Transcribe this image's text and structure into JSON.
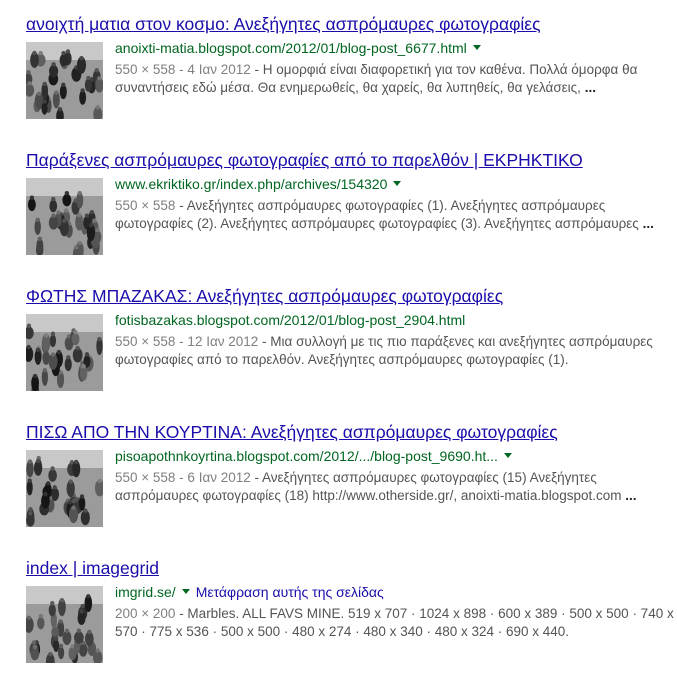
{
  "results": [
    {
      "title": "ανοιχτή ματια στον κοσμο: Ανεξήγητες ασπρόμαυρες φωτογραφίες",
      "url": "anoixti-matia.blogspot.com/2012/01/blog-post_6677.html",
      "meta": "550 × 558 - 4 Ιαν 2012",
      "snippet": " - Η ομορφιά είναι διαφορετική για τον καθένα. Πολλά όμορφα θα συναντήσεις εδώ μέσα. Θα ενημερωθείς, θα χαρείς, θα λυπηθείς, θα γελάσεις, ",
      "ellipsis": "..."
    },
    {
      "title": "Παράξενες ασπρόμαυρες φωτογραφίες από το παρελθόν | ΕΚΡΗΚΤΙΚΟ",
      "url": "www.ekriktiko.gr/index.php/archives/154320",
      "meta": "550 × 558",
      "snippet": " - Ανεξήγητες ασπρόμαυρες φωτογραφίες (1). Ανεξήγητες ασπρόμαυρες φωτογραφίες (2). Ανεξήγητες ασπρόμαυρες φωτογραφίες (3). Ανεξήγητες ασπρόμαυρες ",
      "ellipsis": "..."
    },
    {
      "title": "ΦΩΤΗΣ ΜΠΑΖΑΚΑΣ: Ανεξήγητες ασπρόμαυρες φωτογραφίες",
      "url": "fotisbazakas.blogspot.com/2012/01/blog-post_2904.html",
      "meta": "550 × 558 - 12 Ιαν 2012",
      "snippet": " - Μια συλλογή με τις πιο παράξενες και ανεξήγητες ασπρόμαυρες φωτογραφίες από το παρελθόν. Ανεξήγητες ασπρόμαυρες φωτογραφίες (1).",
      "ellipsis": ""
    },
    {
      "title": "ΠΙΣΩ ΑΠΟ ΤΗΝ ΚΟΥΡΤΙΝΑ: Ανεξήγητες ασπρόμαυρες φωτογραφίες",
      "url": "pisoapothnkoyrtina.blogspot.com/2012/.../blog-post_9690.ht...",
      "meta": "550 × 558 - 6 Ιαν 2012",
      "snippet": " - Ανεξήγητες ασπρόμαυρες φωτογραφίες (15) Ανεξήγητες ασπρόμαυρες φωτογραφίες (18) http://www.otherside.gr/, anoixti-matia.blogspot.com ",
      "ellipsis": "..."
    },
    {
      "title": "index | imagegrid",
      "url": "imgrid.se/",
      "translate": "Μετάφραση αυτής της σελίδας",
      "meta": "200 × 200",
      "snippet": " - Marbles. ALL FAVS MINE. 519 x 707 · 1024 x 898 · 600 x 389 · 500 x 500 · 740 x 570 · 775 x 536 · 500 x 500 · 480 x 274 · 480 x 340 · 480 x 324 · 690 x 440.",
      "ellipsis": ""
    }
  ]
}
